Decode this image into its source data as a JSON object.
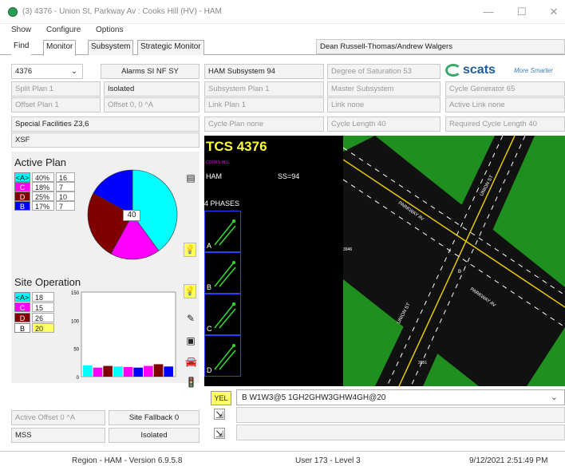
{
  "window": {
    "title": "(3) 4376 - Union St, Parkway Av : Cooks Hill (HV) - HAM",
    "minimize": "—",
    "maximize": "☐",
    "close": "✕"
  },
  "menu": [
    "Show",
    "Configure",
    "Options"
  ],
  "tabs": [
    "Find",
    "Monitor",
    "Subsystem",
    "Strategic Monitor"
  ],
  "operators": "Dean Russell-Thomas/Andrew Walgers",
  "site_select": "4376",
  "grid": {
    "alarms": "Alarms SI NF SY",
    "split_plan": "Split Plan 1",
    "isolated": "Isolated",
    "offset_plan": "Offset Plan 1",
    "offset": "Offset 0, 0 ^A",
    "special": "Special Facilities  Z3,6",
    "xsf": "XSF",
    "subsystem": "HAM Subsystem 94",
    "subsystem_plan": "Subsystem Plan 1",
    "link_plan": "Link Plan 1",
    "cycle_plan": "Cycle Plan none",
    "dos": "Degree of Saturation 53",
    "master": "Master Subsystem",
    "link": "Link none",
    "cycle_length": "Cycle Length 40",
    "logo": "scats",
    "logo_tag": "More Smarter",
    "cycle_gen": "Cycle Generator 65",
    "active_link": "Active Link none",
    "req_cycle": "Required Cycle Length 40"
  },
  "active_plan": {
    "title": "Active Plan",
    "rows": [
      {
        "label": "<A>",
        "pct": "40%",
        "val": "16",
        "color": "#00ffff"
      },
      {
        "label": "C",
        "pct": "18%",
        "val": "7",
        "color": "#ff00ff"
      },
      {
        "label": "D",
        "pct": "25%",
        "val": "10",
        "color": "#800000"
      },
      {
        "label": "B",
        "pct": "17%",
        "val": "7",
        "color": "#0000ff"
      }
    ],
    "pie_center": "40"
  },
  "site_operation": {
    "title": "Site Operation",
    "rows": [
      {
        "label": "<A>",
        "val": "18",
        "color": "#00ffff"
      },
      {
        "label": "C",
        "val": "15",
        "color": "#ff00ff"
      },
      {
        "label": "D",
        "val": "26",
        "color": "#800000"
      },
      {
        "label": "B",
        "val": "20",
        "color": "#ffffff"
      }
    ],
    "axis": [
      "150",
      "100",
      "50",
      "0"
    ],
    "bars": [
      20,
      16,
      19,
      18,
      17,
      16,
      19,
      22,
      18
    ]
  },
  "map": {
    "site": "TCS 4376",
    "place": "COOKS HILL",
    "region": "HAM",
    "ss": "SS=94",
    "phases": "4 PHASES",
    "phase_labels": [
      "A",
      "B",
      "C",
      "D"
    ],
    "street1": "PARKWAY AV",
    "street2": "UNION ST",
    "num1": "3946",
    "num2": "3951",
    "num3": "B"
  },
  "lower": {
    "yel": "YEL",
    "command": "B W1W3@5 1GH2GHW3GHW4GH@20",
    "active_offset": "Active Offset 0 ^A",
    "site_fallback": "Site Fallback 0",
    "mss": "MSS",
    "isolated": "Isolated"
  },
  "status": {
    "region": "Region - HAM - Version 6.9.5.8",
    "user": "User 173 - Level 3",
    "datetime": "9/12/2021  2:51:49 PM"
  }
}
